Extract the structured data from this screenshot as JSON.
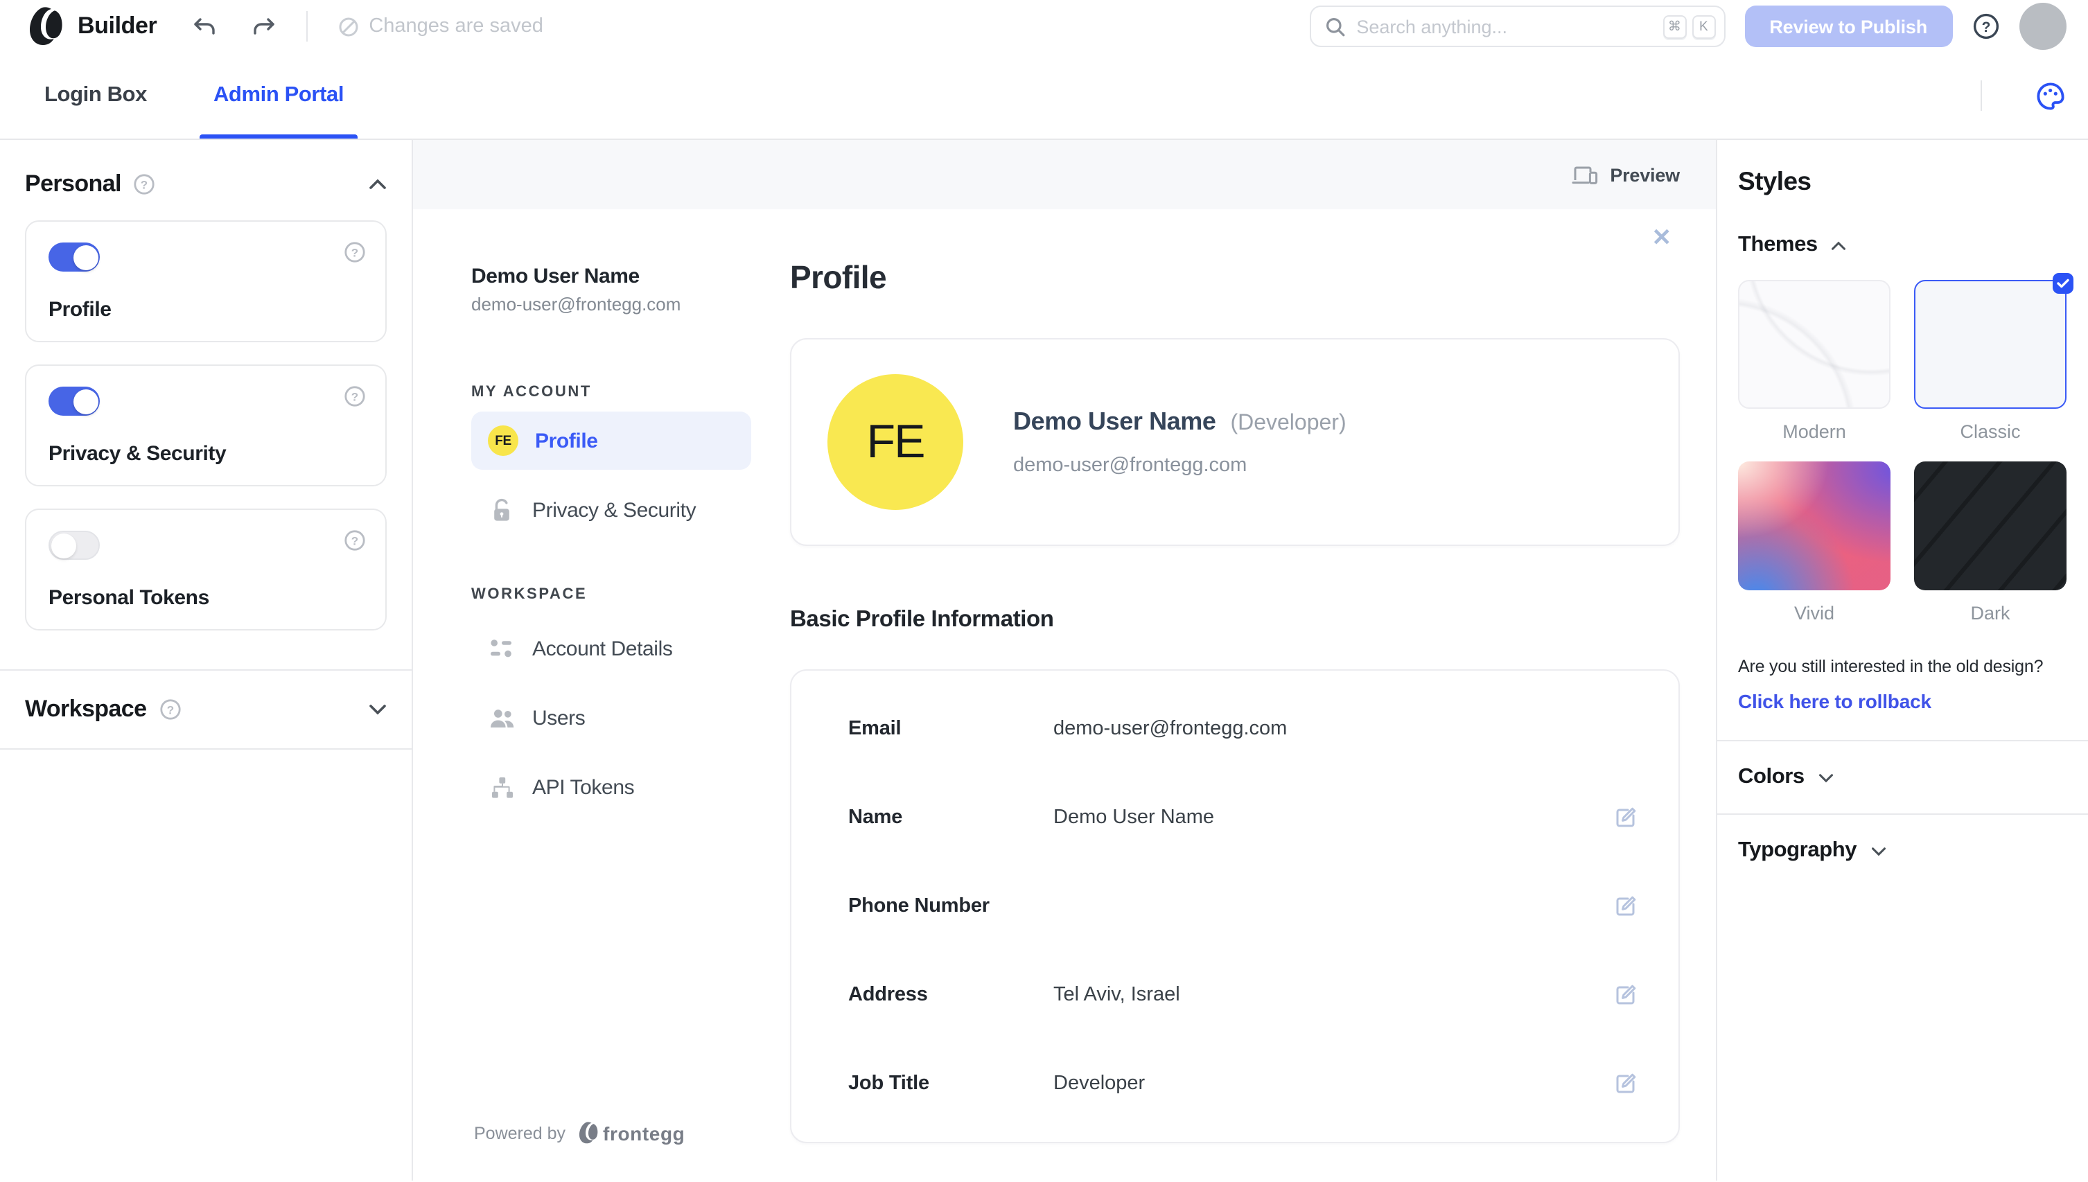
{
  "header": {
    "app_title": "Builder",
    "status": "Changes are saved",
    "search_placeholder": "Search anything...",
    "shortcut_keys": [
      "⌘",
      "K"
    ],
    "publish_button": "Review to Publish"
  },
  "tabs": [
    {
      "label": "Login Box",
      "active": false
    },
    {
      "label": "Admin Portal",
      "active": true
    }
  ],
  "left_panel": {
    "sections": [
      {
        "title": "Personal",
        "collapsed": false,
        "cards": [
          {
            "label": "Profile",
            "enabled": true
          },
          {
            "label": "Privacy & Security",
            "enabled": true
          },
          {
            "label": "Personal Tokens",
            "enabled": false
          }
        ]
      },
      {
        "title": "Workspace",
        "collapsed": true,
        "cards": []
      }
    ]
  },
  "canvas": {
    "preview_label": "Preview",
    "user": {
      "name": "Demo User Name",
      "email": "demo-user@frontegg.com",
      "initials": "FE",
      "role": "(Developer)"
    },
    "nav": {
      "sections": [
        {
          "label": "MY ACCOUNT",
          "items": [
            {
              "label": "Profile",
              "active": true
            },
            {
              "label": "Privacy & Security",
              "active": false
            }
          ]
        },
        {
          "label": "WORKSPACE",
          "items": [
            {
              "label": "Account Details",
              "active": false
            },
            {
              "label": "Users",
              "active": false
            },
            {
              "label": "API Tokens",
              "active": false
            }
          ]
        }
      ]
    },
    "footer": {
      "powered_by": "Powered by",
      "brand": "frontegg"
    },
    "content": {
      "title": "Profile",
      "section_title": "Basic Profile Information",
      "fields": [
        {
          "label": "Email",
          "value": "demo-user@frontegg.com",
          "editable": false
        },
        {
          "label": "Name",
          "value": "Demo User Name",
          "editable": true
        },
        {
          "label": "Phone Number",
          "value": "",
          "editable": true
        },
        {
          "label": "Address",
          "value": "Tel Aviv, Israel",
          "editable": true
        },
        {
          "label": "Job Title",
          "value": "Developer",
          "editable": true
        }
      ]
    }
  },
  "styles_panel": {
    "title": "Styles",
    "themes": {
      "title": "Themes",
      "options": [
        {
          "name": "Modern",
          "selected": false
        },
        {
          "name": "Classic",
          "selected": true
        },
        {
          "name": "Vivid",
          "selected": false
        },
        {
          "name": "Dark",
          "selected": false
        }
      ]
    },
    "rollback": {
      "question": "Are you still interested in the old design?",
      "link": "Click here to rollback"
    },
    "sections": [
      {
        "title": "Colors"
      },
      {
        "title": "Typography"
      }
    ]
  },
  "colors": {
    "accent": "#2b52f5",
    "toggle_on": "#4765e6",
    "publish_button_bg": "#b3c0f7",
    "active_item_bg": "#eef2fc",
    "avatar_yellow": "#f9e851",
    "link": "#4053e8"
  }
}
